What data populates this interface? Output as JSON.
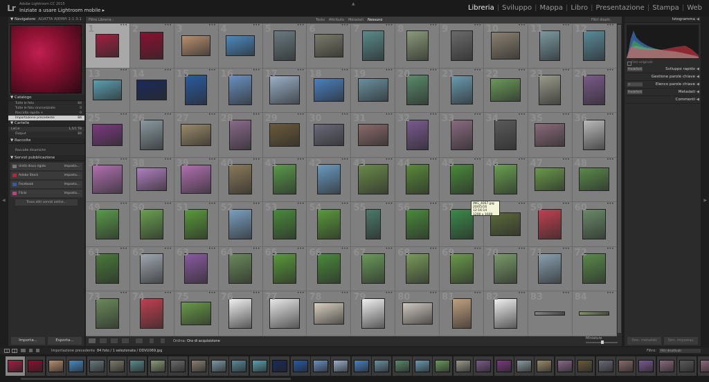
{
  "app": {
    "logo": "Lr",
    "subtitle": "Adobe Lightroom CC 2015",
    "title": "Iniziate a usare Lightroom mobile",
    "title_arrow": "▸"
  },
  "modules": [
    "Libreria",
    "Sviluppo",
    "Mappa",
    "Libro",
    "Presentazione",
    "Stampa",
    "Web"
  ],
  "active_module": "Libreria",
  "left": {
    "navigator": {
      "title": "Navigatore",
      "opts": "ADATTA  RIEMPI  1:1  3:1"
    },
    "catalog": {
      "title": "Catalogo",
      "items": [
        {
          "label": "Tutte le foto",
          "count": "84"
        },
        {
          "label": "Tutte le foto sincronizzate",
          "count": "0"
        },
        {
          "label": "Raccolta rapida +",
          "count": "0"
        },
        {
          "label": "Importazione precedente",
          "count": "84"
        }
      ]
    },
    "folders": {
      "title": "Cartelle",
      "volume": {
        "label": "LaCie",
        "count": "1,5/1 TB"
      },
      "items": [
        {
          "label": "Output",
          "count": "84"
        }
      ]
    },
    "collections": {
      "title": "Raccolte",
      "items": [
        {
          "label": "Raccolte dinamiche",
          "count": ""
        }
      ]
    },
    "publish": {
      "title": "Servizi pubblicazione",
      "items": [
        {
          "label": "Unità disco rigido",
          "action": "Imposta..."
        },
        {
          "label": "Adobe Stock",
          "action": "Imposta..."
        },
        {
          "label": "Facebook",
          "action": "Imposta..."
        },
        {
          "label": "Flickr",
          "action": "Imposta..."
        }
      ],
      "find_more": "Trova altri servizi online..."
    },
    "import_btn": "Importa...",
    "export_btn": "Esporta..."
  },
  "filter_bar": {
    "title": "Filtro Libreria :",
    "tabs": [
      "Testo",
      "Attributo",
      "Metadati",
      "Nessuno"
    ],
    "active_tab": "Nessuno",
    "right": "Filtri disatt."
  },
  "grid": {
    "selected": 1,
    "cells": [
      {
        "n": "1",
        "w": 34,
        "h": 34,
        "c": "#a02040"
      },
      {
        "n": "2",
        "w": 34,
        "h": 40,
        "c": "#8a1030"
      },
      {
        "n": "3",
        "w": 42,
        "h": 30,
        "c": "#b89070"
      },
      {
        "n": "4",
        "w": 42,
        "h": 30,
        "c": "#4a8ac0"
      },
      {
        "n": "5",
        "w": 32,
        "h": 44,
        "c": "#6a7a80"
      },
      {
        "n": "6",
        "w": 42,
        "h": 34,
        "c": "#7a7a6a"
      },
      {
        "n": "7",
        "w": 32,
        "h": 44,
        "c": "#5a8a8a"
      },
      {
        "n": "8",
        "w": 32,
        "h": 44,
        "c": "#8a9a7a"
      },
      {
        "n": "9",
        "w": 32,
        "h": 44,
        "c": "#6a6a6a"
      },
      {
        "n": "10",
        "w": 42,
        "h": 40,
        "c": "#8a8070"
      },
      {
        "n": "11",
        "w": 30,
        "h": 44,
        "c": "#7a9aa0"
      },
      {
        "n": "12",
        "w": 32,
        "h": 44,
        "c": "#5a8a9a"
      },
      {
        "n": "13",
        "w": 42,
        "h": 30,
        "c": "#5aa0b0"
      },
      {
        "n": "14",
        "w": 44,
        "h": 30,
        "c": "#1a2a5a"
      },
      {
        "n": "15",
        "w": 32,
        "h": 44,
        "c": "#2a5aa0"
      },
      {
        "n": "16",
        "w": 34,
        "h": 44,
        "c": "#6a90c0"
      },
      {
        "n": "17",
        "w": 44,
        "h": 42,
        "c": "#9ab0c8"
      },
      {
        "n": "18",
        "w": 44,
        "h": 34,
        "c": "#4a80c0"
      },
      {
        "n": "19",
        "w": 44,
        "h": 34,
        "c": "#6a90a0"
      },
      {
        "n": "20",
        "w": 32,
        "h": 44,
        "c": "#5a8a6a"
      },
      {
        "n": "21",
        "w": 32,
        "h": 42,
        "c": "#6a9ab0"
      },
      {
        "n": "22",
        "w": 44,
        "h": 34,
        "c": "#6a9a5a"
      },
      {
        "n": "23",
        "w": 32,
        "h": 44,
        "c": "#9a9a8a"
      },
      {
        "n": "24",
        "w": 32,
        "h": 44,
        "c": "#7a5a8a"
      },
      {
        "n": "25",
        "w": 44,
        "h": 32,
        "c": "#7a3a80"
      },
      {
        "n": "26",
        "w": 34,
        "h": 44,
        "c": "#8a9aa0"
      },
      {
        "n": "27",
        "w": 44,
        "h": 32,
        "c": "#9a8a6a"
      },
      {
        "n": "28",
        "w": 32,
        "h": 44,
        "c": "#8a6a8a"
      },
      {
        "n": "29",
        "w": 44,
        "h": 34,
        "c": "#6a5a3a"
      },
      {
        "n": "30",
        "w": 44,
        "h": 32,
        "c": "#6a6a7a"
      },
      {
        "n": "31",
        "w": 44,
        "h": 32,
        "c": "#8a6a6a"
      },
      {
        "n": "32",
        "w": 32,
        "h": 44,
        "c": "#7a5a90"
      },
      {
        "n": "33",
        "w": 32,
        "h": 44,
        "c": "#8a6a80"
      },
      {
        "n": "34",
        "w": 32,
        "h": 44,
        "c": "#5a5a5a"
      },
      {
        "n": "35",
        "w": 44,
        "h": 34,
        "c": "#8a6a7a"
      },
      {
        "n": "36",
        "w": 32,
        "h": 44,
        "c": "#bababa"
      },
      {
        "n": "37",
        "w": 44,
        "h": 42,
        "c": "#b070b0"
      },
      {
        "n": "38",
        "w": 44,
        "h": 34,
        "c": "#b080c0"
      },
      {
        "n": "39",
        "w": 44,
        "h": 42,
        "c": "#b070b0"
      },
      {
        "n": "40",
        "w": 34,
        "h": 44,
        "c": "#8a7a5a"
      },
      {
        "n": "41",
        "w": 34,
        "h": 44,
        "c": "#5a9a4a"
      },
      {
        "n": "42",
        "w": 34,
        "h": 44,
        "c": "#6a9ac0"
      },
      {
        "n": "43",
        "w": 44,
        "h": 44,
        "c": "#6a8a4a"
      },
      {
        "n": "44",
        "w": 34,
        "h": 44,
        "c": "#5a8a3a"
      },
      {
        "n": "45",
        "w": 34,
        "h": 44,
        "c": "#4a8a3a"
      },
      {
        "n": "46",
        "w": 34,
        "h": 44,
        "c": "#6aa050"
      },
      {
        "n": "47",
        "w": 44,
        "h": 34,
        "c": "#6a9a4a"
      },
      {
        "n": "48",
        "w": 44,
        "h": 34,
        "c": "#5a8a4a"
      },
      {
        "n": "49",
        "w": 34,
        "h": 44,
        "c": "#5a9a4a"
      },
      {
        "n": "50",
        "w": 34,
        "h": 44,
        "c": "#6aa050"
      },
      {
        "n": "51",
        "w": 34,
        "h": 44,
        "c": "#5a9a3a"
      },
      {
        "n": "52",
        "w": 34,
        "h": 44,
        "c": "#7aa0c0"
      },
      {
        "n": "53",
        "w": 34,
        "h": 44,
        "c": "#4a8a3a"
      },
      {
        "n": "54",
        "w": 34,
        "h": 44,
        "c": "#5a9a3a"
      },
      {
        "n": "55",
        "w": 22,
        "h": 44,
        "c": "#4a7a6a"
      },
      {
        "n": "56",
        "w": 34,
        "h": 44,
        "c": "#4a8a3a"
      },
      {
        "n": "57",
        "w": 34,
        "h": 44,
        "c": "#3a8a4a"
      },
      {
        "n": "58",
        "w": 44,
        "h": 34,
        "c": "#5a6a3a"
      },
      {
        "n": "59",
        "w": 34,
        "h": 44,
        "c": "#c04050"
      },
      {
        "n": "60",
        "w": 34,
        "h": 44,
        "c": "#6a8a6a"
      },
      {
        "n": "61",
        "w": 34,
        "h": 44,
        "c": "#4a7a3a"
      },
      {
        "n": "62",
        "w": 34,
        "h": 44,
        "c": "#a0a8b0"
      },
      {
        "n": "63",
        "w": 34,
        "h": 44,
        "c": "#8a5aa0"
      },
      {
        "n": "64",
        "w": 34,
        "h": 44,
        "c": "#6a8a5a"
      },
      {
        "n": "65",
        "w": 34,
        "h": 44,
        "c": "#5a9a3a"
      },
      {
        "n": "66",
        "w": 34,
        "h": 44,
        "c": "#4a8a3a"
      },
      {
        "n": "67",
        "w": 34,
        "h": 44,
        "c": "#6a9a5a"
      },
      {
        "n": "68",
        "w": 34,
        "h": 44,
        "c": "#7a9a5a"
      },
      {
        "n": "69",
        "w": 34,
        "h": 44,
        "c": "#6a9a4a"
      },
      {
        "n": "70",
        "w": 34,
        "h": 44,
        "c": "#7a9a6a"
      },
      {
        "n": "71",
        "w": 34,
        "h": 44,
        "c": "#8aa0b0"
      },
      {
        "n": "72",
        "w": 34,
        "h": 44,
        "c": "#5a8a4a"
      },
      {
        "n": "73",
        "w": 34,
        "h": 44,
        "c": "#6a8a5a"
      },
      {
        "n": "74",
        "w": 34,
        "h": 44,
        "c": "#c04050"
      },
      {
        "n": "75",
        "w": 44,
        "h": 34,
        "c": "#6a9a4a"
      },
      {
        "n": "76",
        "w": 34,
        "h": 44,
        "c": "#f0f0f0"
      },
      {
        "n": "77",
        "w": 44,
        "h": 44,
        "c": "#e8e8e8"
      },
      {
        "n": "78",
        "w": 44,
        "h": 32,
        "c": "#d8d0c0"
      },
      {
        "n": "79",
        "w": 34,
        "h": 44,
        "c": "#f0f0f0"
      },
      {
        "n": "80",
        "w": 44,
        "h": 32,
        "c": "#d0c8c0"
      },
      {
        "n": "81",
        "w": 28,
        "h": 44,
        "c": "#c0a080"
      },
      {
        "n": "82",
        "w": 34,
        "h": 44,
        "c": "#f0f0f0"
      },
      {
        "n": "83",
        "w": 44,
        "h": 6,
        "c": "#8a8a8a"
      },
      {
        "n": "84",
        "w": 44,
        "h": 6,
        "c": "#8a9a6a"
      }
    ]
  },
  "tooltip": {
    "lines": [
      "IMG_4067.jpg",
      "20/05/16 12:16:14",
      "1200 x 1600"
    ]
  },
  "toolbar": {
    "sort_label": "Ordina:",
    "sort_value": "Ora di acquisizione",
    "thumbnails_label": "Miniature"
  },
  "right": {
    "histogram_title": "Istogramma",
    "original_photo": "Foto originale",
    "rows": [
      {
        "label": "Sviluppo rapido",
        "small": "Predefiniti"
      },
      {
        "label": "Gestione parole chiave",
        "small": ""
      },
      {
        "label": "Elenco parole chiave",
        "small": "+"
      },
      {
        "label": "Metadati",
        "small": "Predefiniti"
      },
      {
        "label": "Commenti",
        "small": ""
      }
    ],
    "sync_btn": "Sinc. metadati",
    "sync_settings_btn": "Sinc. impostaz."
  },
  "filmstrip_bar": {
    "screen1": "1",
    "screen2": "2",
    "source": "Importazione precedente",
    "count": "84 foto / 1 selezionata / DDVU069.jpg",
    "filter_label": "Filtro:",
    "filter_value": "Filtri disattivati"
  },
  "filmstrip": {
    "selected": 1,
    "colors": [
      "#a02040",
      "#8a1030",
      "#b89070",
      "#4a8ac0",
      "#6a7a80",
      "#7a7a6a",
      "#5a8a8a",
      "#8a9a7a",
      "#6a6a6a",
      "#8a8070",
      "#7a9aa0",
      "#5a8a9a",
      "#5aa0b0",
      "#1a2a5a",
      "#2a5aa0",
      "#6a90c0",
      "#9ab0c8",
      "#4a80c0",
      "#6a90a0",
      "#5a8a6a",
      "#6a9ab0",
      "#6a9a5a",
      "#9a9a8a",
      "#7a5a8a",
      "#7a3a80",
      "#8a9aa0",
      "#9a8a6a",
      "#8a6a8a",
      "#6a5a3a",
      "#6a6a7a",
      "#8a6a6a",
      "#7a5a90",
      "#8a6a80",
      "#5a5a5a",
      "#8a6a7a"
    ]
  },
  "colors": {
    "accent_text": "#f0f0f0",
    "grid_bg": "#7f7f7f",
    "selected_cell": "#a8a8a8",
    "tooltip_bg": "#f4f4d8"
  }
}
